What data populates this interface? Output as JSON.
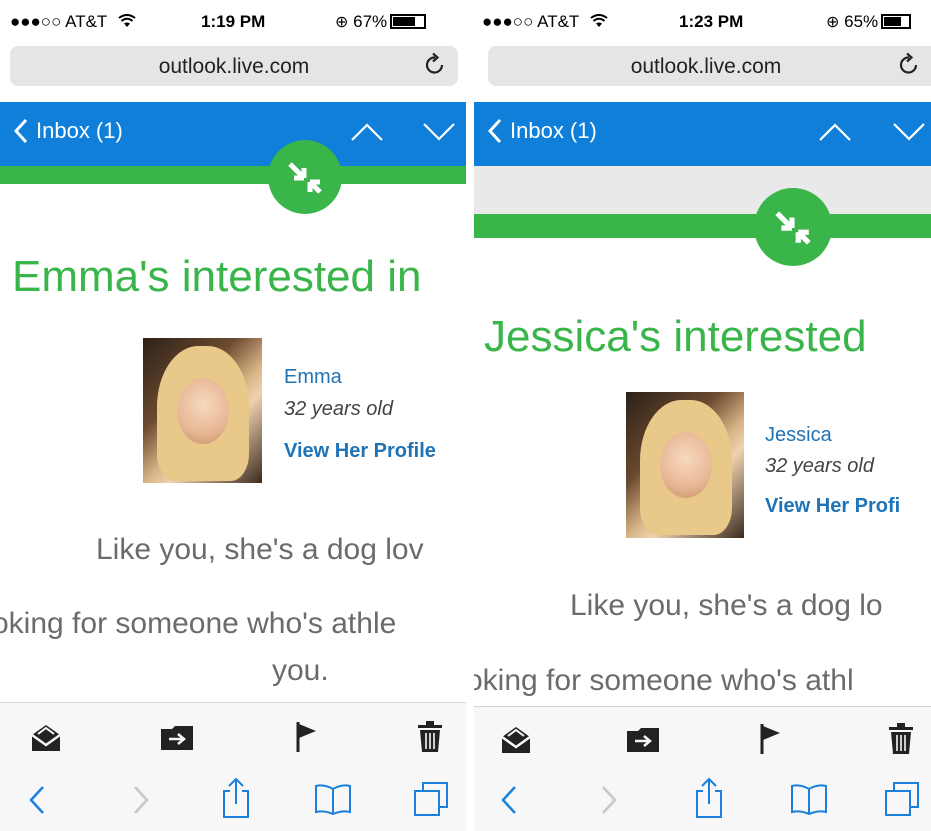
{
  "left": {
    "status": {
      "carrier": "●●●○○ AT&T",
      "time": "1:19 PM",
      "battery": "67%",
      "battery_level": 0.67
    },
    "address_bar": {
      "url": "outlook.live.com"
    },
    "mail_header": {
      "back_label": "Inbox (1)"
    },
    "email": {
      "headline": "Emma's interested in",
      "name": "Emma",
      "age": "32 years old",
      "profile_link": "View Her Profile",
      "body_line1": "Like you, she's a dog lov",
      "body_line2": "oking for someone who's athle",
      "body_line3": "you."
    }
  },
  "right": {
    "status": {
      "carrier": "●●●○○ AT&T",
      "time": "1:23 PM",
      "battery": "65%",
      "battery_level": 0.65
    },
    "address_bar": {
      "url": "outlook.live.com"
    },
    "mail_header": {
      "back_label": "Inbox (1)"
    },
    "email": {
      "headline": "Jessica's interested",
      "name": "Jessica",
      "age": "32 years old",
      "profile_link": "View Her Profi",
      "body_line1": "Like you, she's a dog lo",
      "body_line2": "oking for someone who's athl"
    }
  },
  "icons": {
    "mark_unread": "envelope-open-icon",
    "move": "move-to-folder-icon",
    "flag": "flag-icon",
    "delete": "trash-icon",
    "back": "safari-back-icon",
    "forward": "safari-forward-icon",
    "share": "share-icon",
    "bookmarks": "bookmarks-icon",
    "tabs": "tabs-icon",
    "reload": "reload-icon",
    "lock_rotation": "rotation-lock-icon"
  },
  "colors": {
    "header_blue": "#0f7fd9",
    "brand_green": "#39b54a",
    "link_blue": "#1f73b7",
    "toolbar_icon_blue": "#1b7fdb"
  }
}
